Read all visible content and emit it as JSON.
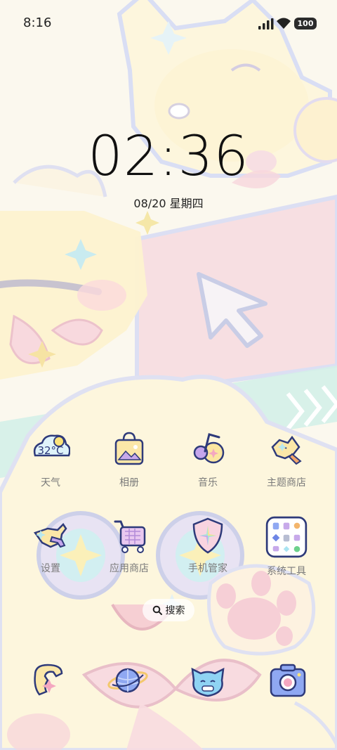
{
  "status_bar": {
    "time": "8:16",
    "battery": "100",
    "icons": [
      "signal-icon",
      "wifi-icon",
      "battery-icon"
    ]
  },
  "lock_clock": {
    "time": "02:36",
    "date": "08/20 星期四"
  },
  "apps_row1": [
    {
      "label": "天气",
      "icon": "weather-icon",
      "badge": "32°C"
    },
    {
      "label": "相册",
      "icon": "gallery-icon"
    },
    {
      "label": "音乐",
      "icon": "music-icon"
    },
    {
      "label": "主题商店",
      "icon": "theme-store-icon"
    }
  ],
  "apps_row2": [
    {
      "label": "设置",
      "icon": "settings-icon"
    },
    {
      "label": "应用商店",
      "icon": "app-store-icon"
    },
    {
      "label": "手机管家",
      "icon": "phone-manager-icon"
    },
    {
      "label": "系统工具",
      "icon": "system-tools-icon"
    }
  ],
  "search": {
    "label": "搜索",
    "icon": "search-icon"
  },
  "dock": [
    {
      "icon": "phone-icon"
    },
    {
      "icon": "browser-planet-icon"
    },
    {
      "icon": "messages-cat-icon"
    },
    {
      "icon": "camera-icon"
    }
  ],
  "colors": {
    "wallpaper_bg": "#fbf7ec",
    "label_gray": "#7a7a7a",
    "outline_navy": "#2e3a7a",
    "pink": "#f6cfd4",
    "mint": "#c9ece3",
    "yellow": "#fbe7a8"
  }
}
